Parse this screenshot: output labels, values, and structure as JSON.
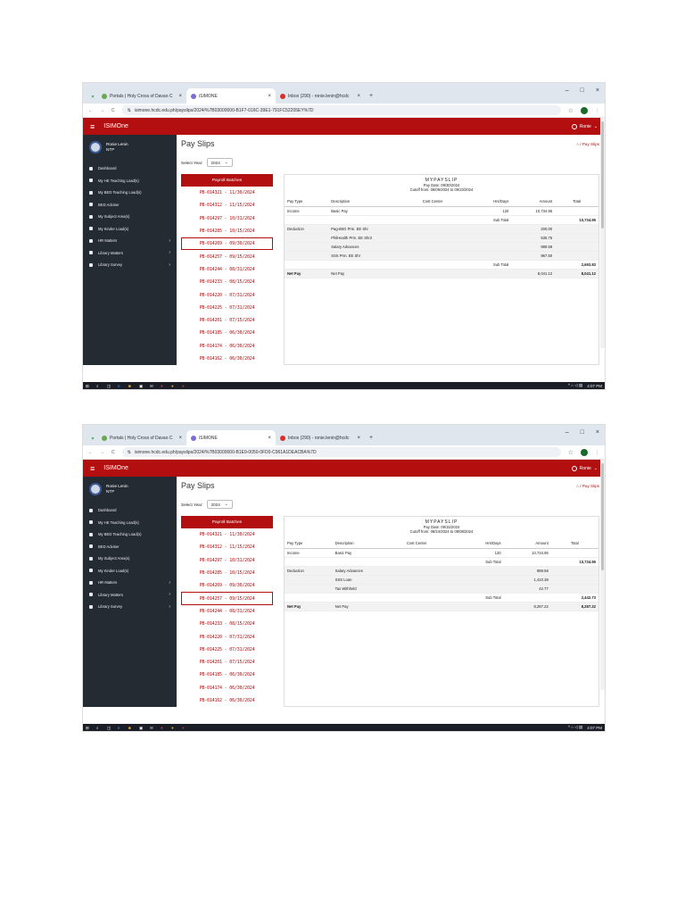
{
  "browser": {
    "tabs": [
      {
        "label": "Portals | Holy Cross of Davao C",
        "icon_color": "#6aa84f"
      },
      {
        "label": "iSIMONE",
        "icon_color": "#7b6fd6"
      },
      {
        "label": "Inbox (290) - ronie.lenin@hcdc",
        "icon_color": "#d93025"
      }
    ],
    "url_1": "isimone.hcdc.edu.ph/payslips/2024/%7B03000000-B1F7-016C-39E1-791FC52205EY%7D",
    "url_2": "isimone.hcdc.edu.ph/payslips/2024/%7B03000000-B1E9-0050-0FD0-C961A1DEACBA%7D",
    "icons": {
      "back": "arrow-left-icon",
      "forward": "arrow-right-icon",
      "reload": "reload-icon",
      "star": "star-icon"
    }
  },
  "app": {
    "name": "ISIMOne",
    "user_menu": "Ronie",
    "profile_name": "Ronie Lenin",
    "profile_role": "NTP",
    "page_title": "Pay Slips",
    "breadcrumb": "Pay Slips",
    "select_year_label": "Select Year:",
    "select_year_value": "2024",
    "nav": [
      {
        "label": "Dashboard",
        "caret": ""
      },
      {
        "label": "My HE Teaching Load(s)",
        "caret": ""
      },
      {
        "label": "My BED Teaching Load(s)",
        "caret": ""
      },
      {
        "label": "BED Adviser",
        "caret": ""
      },
      {
        "label": "My Subject Area(s)",
        "caret": ""
      },
      {
        "label": "My Kinder Load(s)",
        "caret": ""
      },
      {
        "label": "HR Matters",
        "caret": "›"
      },
      {
        "label": "Library Matters",
        "caret": "›"
      },
      {
        "label": "Library Survey",
        "caret": "›"
      }
    ],
    "batches_header": "Payroll Batches",
    "batches": [
      "PB-014321 - 11/30/2024",
      "PB-014312 - 11/15/2024",
      "PB-014297 - 10/31/2024",
      "PB-014285 - 10/15/2024",
      "PB-014269 - 09/30/2024",
      "PB-014257 - 09/15/2024",
      "PB-014244 - 08/31/2024",
      "PB-014233 - 08/15/2024",
      "PB-014220 - 07/31/2024",
      "PB-014225 - 07/31/2024",
      "PB-014201 - 07/15/2024",
      "PB-014185 - 06/30/2024",
      "PB-014174 - 06/30/2024",
      "PB-014162 - 06/30/2024"
    ],
    "columns": [
      "Pay Type",
      "Description",
      "Cost Center",
      "Hrs/Days",
      "Amount",
      "Total"
    ]
  },
  "slip1": {
    "title": "MYPAYSLIP",
    "pay_date": "Pay Date: 09/30/2024",
    "cutoff": "Cutoff from: 09/09/2024  to  09/23/2024",
    "income_type": "Income",
    "income_desc": "Basic Pay",
    "income_hrs": "120",
    "income_amount": "10,734.95",
    "subtotal_label": "Sub Total",
    "income_total": "10,734.95",
    "deduction_type": "Deduction",
    "deductions": [
      {
        "desc": "Pag-IBIG Prm. EE Shr",
        "amount": "200.00"
      },
      {
        "desc": "PhilHealth Prm. EE Shr2",
        "amount": "536.75"
      },
      {
        "desc": "Salary Advances",
        "amount": "989.58"
      },
      {
        "desc": "SSS Prm. EE Shr",
        "amount": "967.50"
      }
    ],
    "deduction_total": "2,693.83",
    "net_type": "Net Pay",
    "net_desc": "Net Pay",
    "net_amount": "8,041.12",
    "net_total": "8,041.12"
  },
  "slip2": {
    "title": "MYPAYSLIP",
    "pay_date": "Pay Date: 09/15/2024",
    "cutoff": "Cutoff from: 08/24/2024  to  09/08/2024",
    "income_type": "Income",
    "income_desc": "Basic Pay",
    "income_hrs": "120",
    "income_amount": "10,734.95",
    "subtotal_label": "Sub Total",
    "income_total": "10,734.95",
    "deduction_type": "Deduction",
    "deductions": [
      {
        "desc": "Salary Advances",
        "amount": "989.58"
      },
      {
        "desc": "SSS Loan",
        "amount": "1,410.38"
      },
      {
        "desc": "Tax Withheld",
        "amount": "42.77"
      }
    ],
    "deduction_total": "2,442.73",
    "net_type": "Net Pay",
    "net_desc": "Net Pay",
    "net_amount": "8,287.22",
    "net_total": "8,287.22"
  },
  "taskbar": {
    "time": "4:07 PM"
  },
  "colors": {
    "brand": "#b30f10",
    "sidebar": "#252b33"
  }
}
